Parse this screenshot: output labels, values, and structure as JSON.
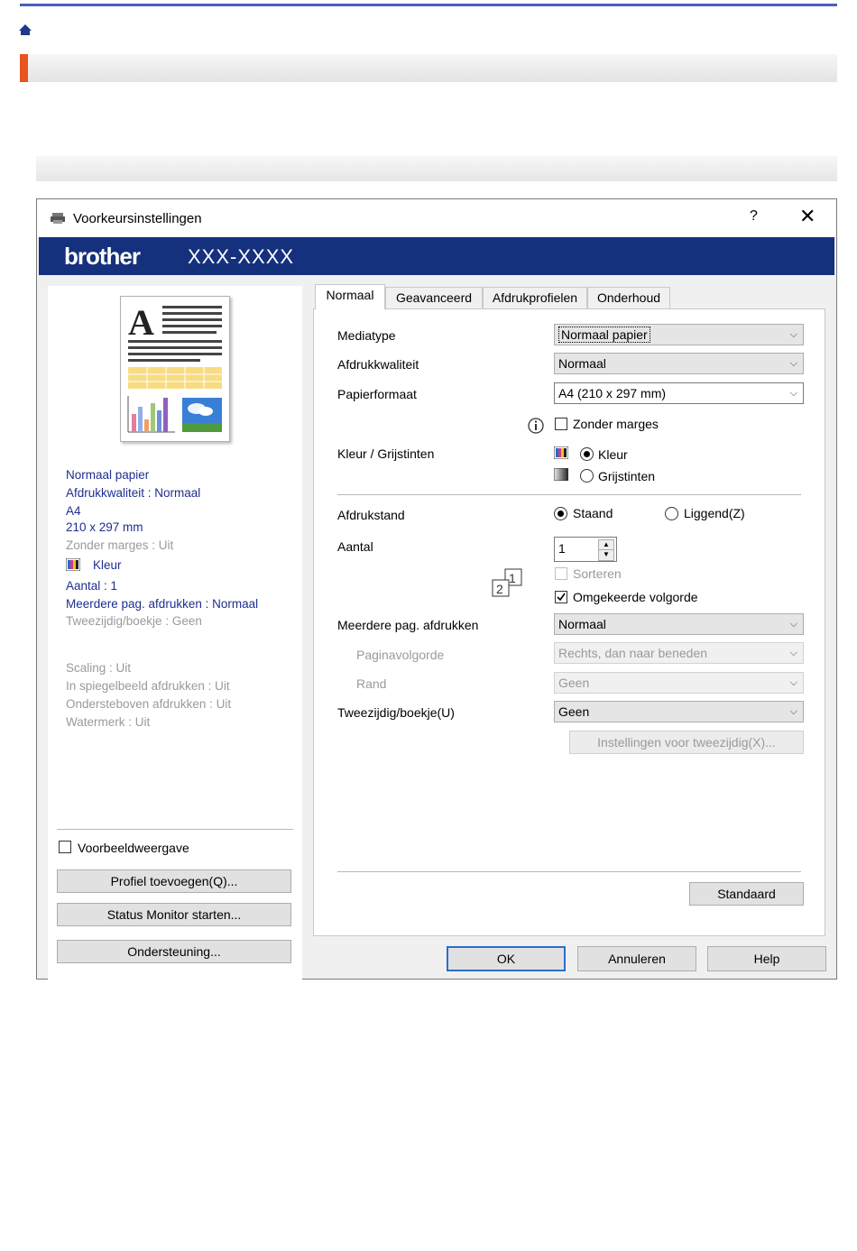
{
  "dialog": {
    "title": "Voorkeursinstellingen",
    "help": "?",
    "close": "✕",
    "brand": "brother",
    "model": "XXX-XXXX"
  },
  "colors": {
    "accent": "#e8531e",
    "brand_bar": "#15307c",
    "summary_text": "#1f2e8f"
  },
  "summary": {
    "media": "Normaal papier",
    "quality": "Afdrukkwaliteit : Normaal",
    "size": "A4",
    "dims": "210 x 297 mm",
    "borderless": "Zonder marges : Uit",
    "color": "Kleur",
    "copies": "Aantal : 1",
    "multipage": "Meerdere pag. afdrukken : Normaal",
    "duplex": "Tweezijdig/boekje : Geen",
    "scaling": "Scaling : Uit",
    "mirror": "In spiegelbeeld afdrukken : Uit",
    "upside": "Ondersteboven afdrukken : Uit",
    "watermark": "Watermerk : Uit"
  },
  "left_controls": {
    "preview_cb": "Voorbeeldweergave",
    "profile_btn": "Profiel toevoegen(Q)...",
    "status_btn": "Status Monitor starten...",
    "support_btn": "Ondersteuning..."
  },
  "tabs": [
    "Normaal",
    "Geavanceerd",
    "Afdrukprofielen",
    "Onderhoud"
  ],
  "form": {
    "mediatype_label": "Mediatype",
    "mediatype_value": "Normaal papier",
    "quality_label": "Afdrukkwaliteit",
    "quality_value": "Normaal",
    "paper_label": "Papierformaat",
    "paper_value": "A4 (210 x 297 mm)",
    "borderless_cb": "Zonder marges",
    "colormode_label": "Kleur / Grijstinten",
    "color_opt": "Kleur",
    "gray_opt": "Grijstinten",
    "orientation_label": "Afdrukstand",
    "portrait": "Staand",
    "landscape": "Liggend(Z)",
    "copies_label": "Aantal",
    "copies_value": "1",
    "collate_cb": "Sorteren",
    "reverse_cb": "Omgekeerde volgorde",
    "multipage_label": "Meerdere pag. afdrukken",
    "multipage_value": "Normaal",
    "pageorder_label": "Paginavolgorde",
    "pageorder_value": "Rechts, dan naar beneden",
    "border_label": "Rand",
    "border_value": "Geen",
    "duplex_label": "Tweezijdig/boekje(U)",
    "duplex_value": "Geen",
    "duplex_settings_btn": "Instellingen voor tweezijdig(X)...",
    "default_btn": "Standaard"
  },
  "footer": {
    "ok": "OK",
    "cancel": "Annuleren",
    "help": "Help"
  }
}
